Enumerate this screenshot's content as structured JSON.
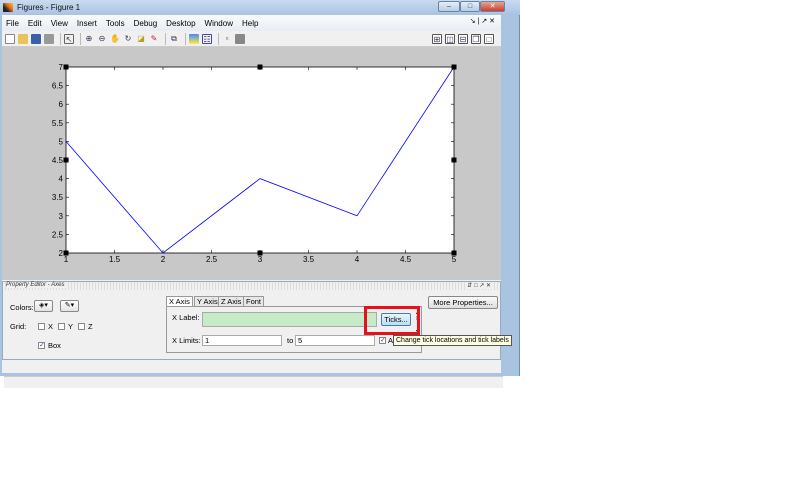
{
  "window": {
    "title": "Figures - Figure 1",
    "controls": [
      "minimize",
      "maximize",
      "close"
    ]
  },
  "menu": {
    "items": [
      "File",
      "Edit",
      "View",
      "Insert",
      "Tools",
      "Debug",
      "Desktop",
      "Window",
      "Help"
    ]
  },
  "toolbar": {
    "icons": [
      "new-figure",
      "open",
      "save",
      "print",
      "edit-plot",
      "zoom-in",
      "zoom-out",
      "pan",
      "rotate-3d",
      "data-cursor",
      "brush",
      "link-plot",
      "insert-colorbar",
      "insert-legend",
      "hide-plot-tools",
      "show-plot-tools"
    ],
    "layout_icons": [
      "tile",
      "left-right",
      "top-bottom",
      "float",
      "maximize"
    ]
  },
  "chart_data": {
    "type": "line",
    "x": [
      1,
      2,
      3,
      4,
      5
    ],
    "y": [
      5,
      2,
      4,
      3,
      7
    ],
    "xlim": [
      1,
      5
    ],
    "ylim": [
      2,
      7
    ],
    "xticks": [
      "1",
      "1.5",
      "2",
      "2.5",
      "3",
      "3.5",
      "4",
      "4.5",
      "5"
    ],
    "yticks": [
      "2",
      "2.5",
      "3",
      "3.5",
      "4",
      "4.5",
      "5",
      "5.5",
      "6",
      "6.5",
      "7"
    ],
    "color": "#0000ff",
    "grid": false
  },
  "property_editor": {
    "title": "Property Editor - Axes",
    "colors_label": "Colors:",
    "grid_label": "Grid:",
    "grid_x": "X",
    "grid_y": "Y",
    "grid_z": "Z",
    "box_label": "Box",
    "box_checked": true,
    "tabs": [
      "X Axis",
      "Y Axis",
      "Z Axis",
      "Font"
    ],
    "active_tab": "X Axis",
    "xlabel_label": "X Label:",
    "xlabel_value": "",
    "ticks_button": "Ticks...",
    "xlimits_label": "X Limits:",
    "xlim_from": "1",
    "to_label": "to",
    "xlim_to": "5",
    "auto_label": "A",
    "more_properties": "More Properties...",
    "tooltip": "Change tick locations and tick labels"
  },
  "colors": {
    "highlight": "#e8101a",
    "xlabel_field": "#c6ebc9"
  }
}
